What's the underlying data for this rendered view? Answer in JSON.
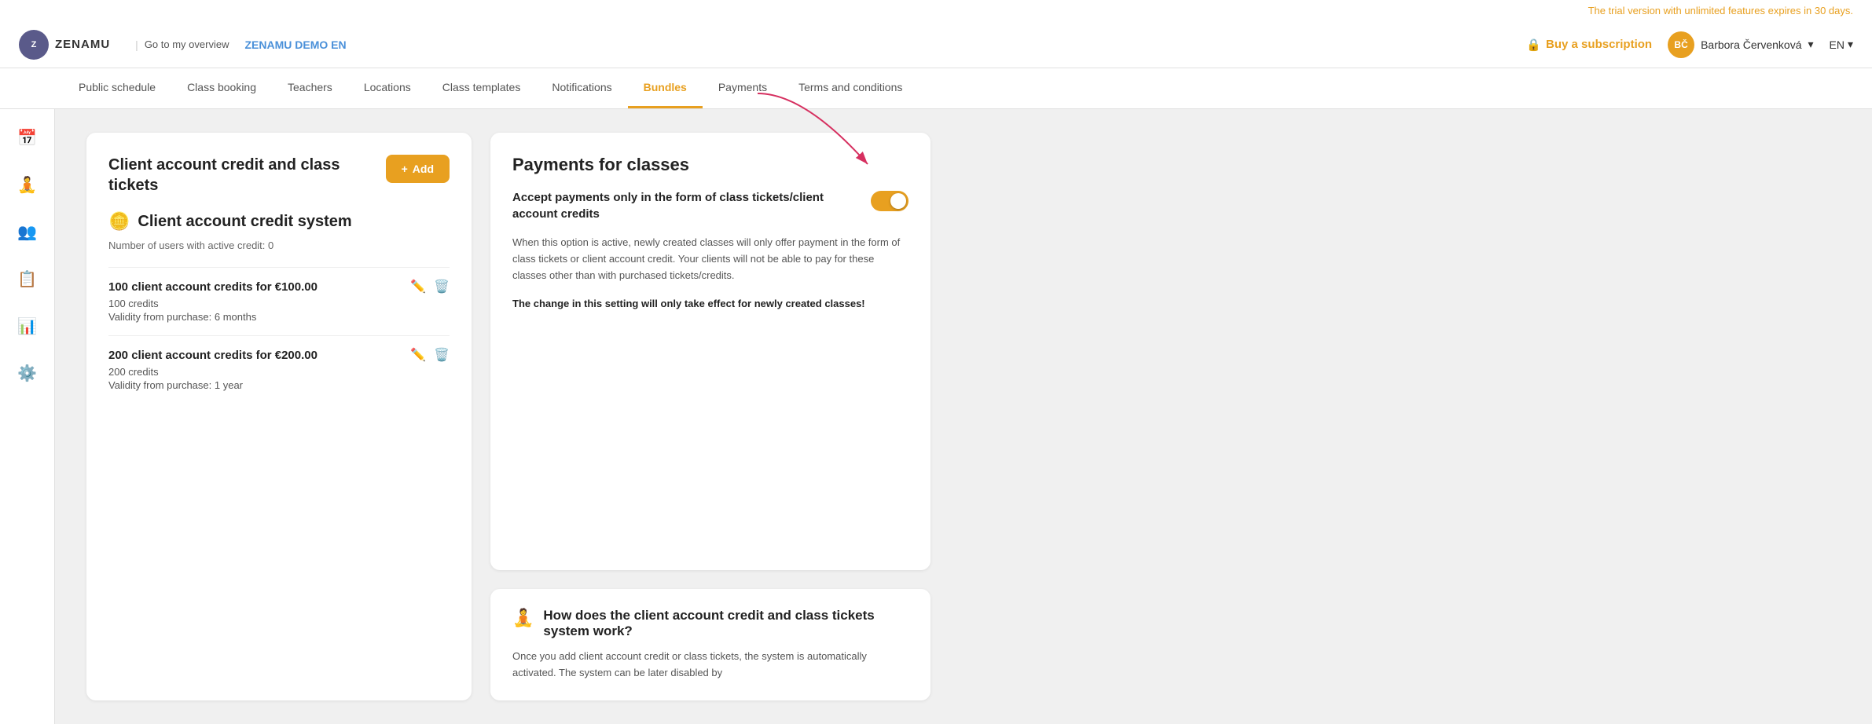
{
  "trial_banner": {
    "text": "The trial version with unlimited features expires in 30 days."
  },
  "header": {
    "logo_text": "ZENAMU",
    "logo_initials": "Z",
    "overview_link": "Go to my overview",
    "demo_text": "ZENAMU DEMO EN",
    "buy_btn": "Buy a subscription",
    "lock_icon": "🔒",
    "user_name": "Barbora Červenková",
    "user_initials": "BČ",
    "lang": "EN"
  },
  "nav": {
    "items": [
      {
        "label": "Public schedule",
        "active": false
      },
      {
        "label": "Class booking",
        "active": false
      },
      {
        "label": "Teachers",
        "active": false
      },
      {
        "label": "Locations",
        "active": false
      },
      {
        "label": "Class templates",
        "active": false
      },
      {
        "label": "Notifications",
        "active": false
      },
      {
        "label": "Bundles",
        "active": true
      },
      {
        "label": "Payments",
        "active": false
      },
      {
        "label": "Terms and conditions",
        "active": false
      }
    ]
  },
  "sidebar": {
    "icons": [
      {
        "name": "calendar-icon",
        "symbol": "📅"
      },
      {
        "name": "person-icon",
        "symbol": "🧘"
      },
      {
        "name": "group-icon",
        "symbol": "👥"
      },
      {
        "name": "clipboard-icon",
        "symbol": "📋"
      },
      {
        "name": "chart-icon",
        "symbol": "📊"
      },
      {
        "name": "settings-icon",
        "symbol": "⚙️"
      }
    ]
  },
  "left_card": {
    "title": "Client account credit and class tickets",
    "add_button": "+ Add",
    "section_icon": "🪙",
    "section_title": "Client account credit system",
    "section_subtitle": "Number of users with active credit: 0",
    "credits": [
      {
        "title": "100 client account credits for €100.00",
        "detail": "100 credits",
        "validity": "Validity from purchase: 6 months"
      },
      {
        "title": "200 client account credits for €200.00",
        "detail": "200 credits",
        "validity": "Validity from purchase: 1 year"
      }
    ]
  },
  "right_card": {
    "title": "Payments for classes",
    "toggle_label": "Accept payments only in the form of class tickets/client account credits",
    "toggle_on": true,
    "description": "When this option is active, newly created classes will only offer payment in the form of class tickets or client account credit. Your clients will not be able to pay for these classes other than with purchased tickets/credits.",
    "warning": "The change in this setting will only take effect for newly created classes!"
  },
  "how_card": {
    "icon": "🧘",
    "title": "How does the client account credit and class tickets system work?",
    "text": "Once you add client account credit or class tickets, the system is automatically activated. The system can be later disabled by"
  }
}
